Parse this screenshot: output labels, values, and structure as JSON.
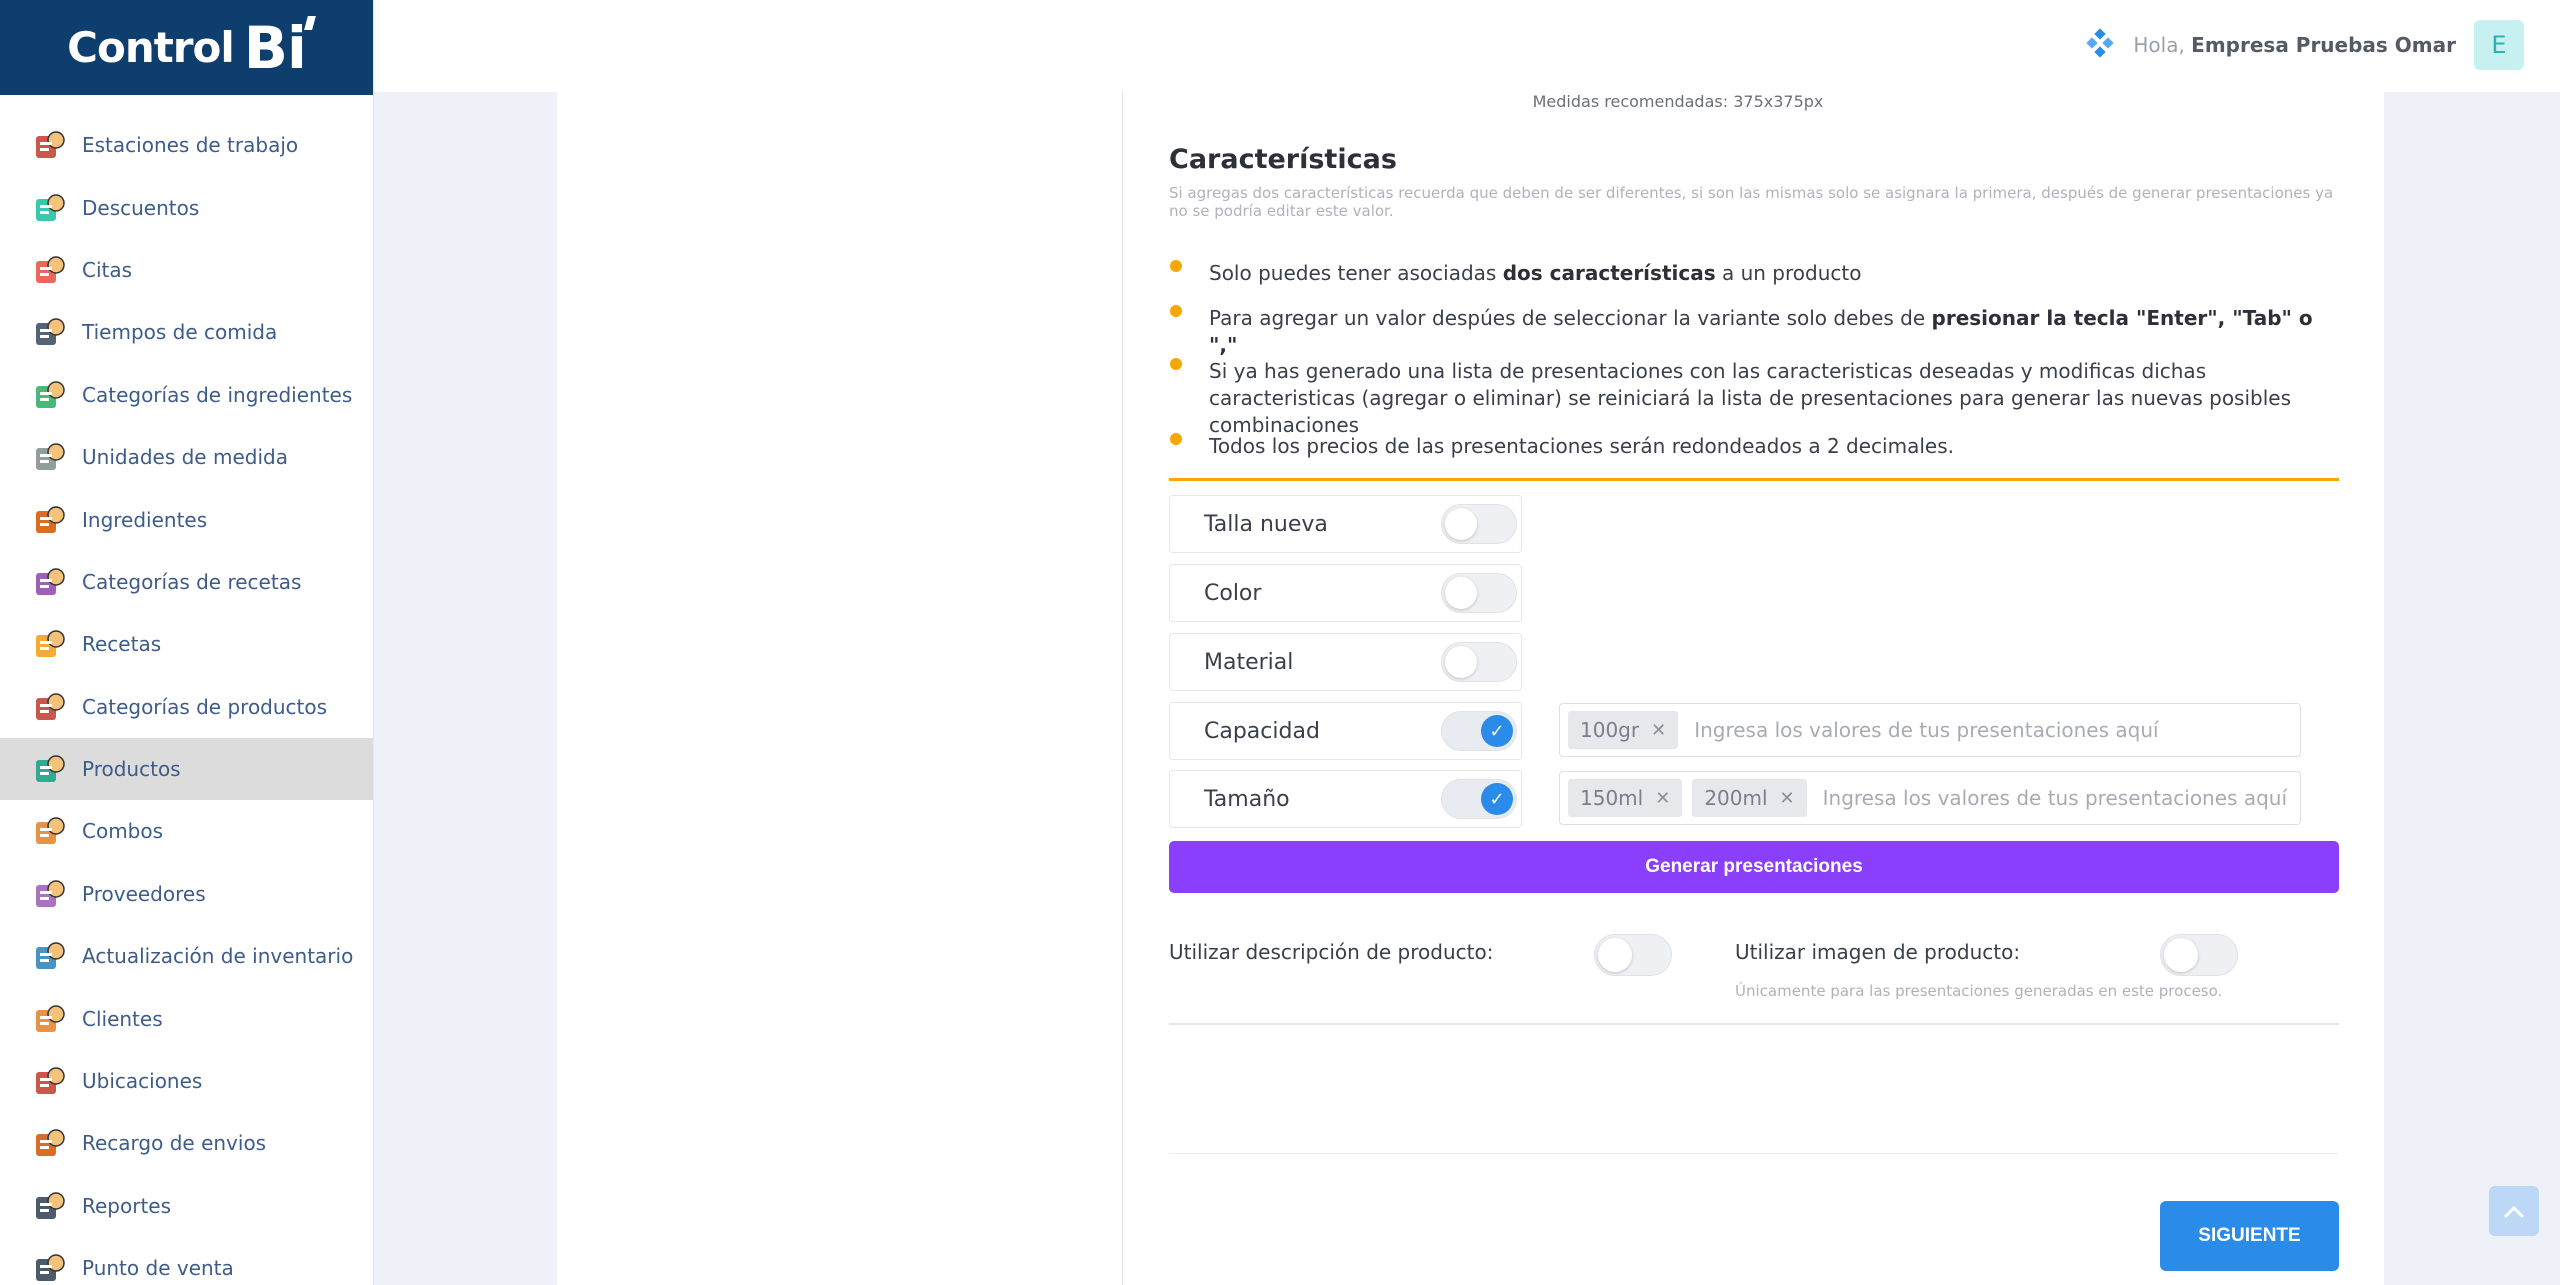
{
  "brand": {
    "name": "Control",
    "suffix": "Bi"
  },
  "sidebar": {
    "items": [
      {
        "label": "Estaciones de trabajo",
        "icon": "workstation-icon",
        "color": "#c0392b"
      },
      {
        "label": "Descuentos",
        "icon": "discount-icon",
        "color": "#1abc9c"
      },
      {
        "label": "Citas",
        "icon": "calendar-icon",
        "color": "#e74c3c"
      },
      {
        "label": "Tiempos de comida",
        "icon": "meal-time-icon",
        "color": "#34495e"
      },
      {
        "label": "Categorías de ingredientes",
        "icon": "ingredient-category-icon",
        "color": "#27ae60"
      },
      {
        "label": "Unidades de medida",
        "icon": "measure-icon",
        "color": "#7f8c8d"
      },
      {
        "label": "Ingredientes",
        "icon": "ingredients-icon",
        "color": "#d35400"
      },
      {
        "label": "Categorías de recetas",
        "icon": "recipe-category-icon",
        "color": "#8e44ad"
      },
      {
        "label": "Recetas",
        "icon": "recipe-icon",
        "color": "#f39c12"
      },
      {
        "label": "Categorías de productos",
        "icon": "product-category-icon",
        "color": "#c0392b"
      },
      {
        "label": "Productos",
        "icon": "products-icon",
        "color": "#16a085"
      },
      {
        "label": "Combos",
        "icon": "combo-icon",
        "color": "#e67e22"
      },
      {
        "label": "Proveedores",
        "icon": "supplier-icon",
        "color": "#9b59b6"
      },
      {
        "label": "Actualización de inventario",
        "icon": "inventory-icon",
        "color": "#2980b9"
      },
      {
        "label": "Clientes",
        "icon": "clients-icon",
        "color": "#e67e22"
      },
      {
        "label": "Ubicaciones",
        "icon": "location-icon",
        "color": "#c0392b"
      },
      {
        "label": "Recargo de envios",
        "icon": "delivery-icon",
        "color": "#d35400"
      },
      {
        "label": "Reportes",
        "icon": "reports-icon",
        "color": "#2c3e50"
      },
      {
        "label": "Punto de venta",
        "icon": "pos-icon",
        "color": "#2c3e50"
      }
    ],
    "active_index": 10
  },
  "header": {
    "greeting": "Hola,",
    "user": "Empresa Pruebas Omar",
    "avatar_letter": "E"
  },
  "form": {
    "medidas": "Medidas recomendadas: 375x375px",
    "title": "Características",
    "subtitle": "Si agregas dos características recuerda que deben de ser diferentes, si son las mismas solo se asignara la primera, después de generar presentaciones ya no se podría editar este valor.",
    "rules": {
      "r1_a": "Solo puedes tener asociadas ",
      "r1_b": "dos características",
      "r1_c": " a un producto",
      "r2_a": "Para agregar un valor despúes de seleccionar la variante solo debes de ",
      "r2_b": "presionar la tecla \"Enter\", \"Tab\" o \",\"",
      "r3": "Si ya has generado una lista de presentaciones con las caracteristicas deseadas y modificas dichas caracteristicas (agregar o eliminar) se reiniciará la lista de presentaciones para generar las nuevas posibles combinaciones",
      "r4": "Todos los precios de las presentaciones serán redondeados a 2 decimales."
    },
    "features": [
      {
        "label": "Talla nueva",
        "enabled": false
      },
      {
        "label": "Color",
        "enabled": false
      },
      {
        "label": "Material",
        "enabled": false
      },
      {
        "label": "Capacidad",
        "enabled": true,
        "tags": [
          "100gr"
        ]
      },
      {
        "label": "Tamaño",
        "enabled": true,
        "tags": [
          "150ml",
          "200ml"
        ]
      }
    ],
    "tag_placeholder": "Ingresa los valores de tus presentaciones aquí",
    "generate_label": "Generar presentaciones",
    "use_description_label": "Utilizar descripción de producto:",
    "use_image_label": "Utilizar imagen de producto:",
    "use_image_note": "Únicamente para las presentaciones generadas en este proceso.",
    "next_label": "SIGUIENTE"
  },
  "colors": {
    "primary": "#2b8be8",
    "accent": "#8a3ffc",
    "warning": "#f5a800",
    "brand": "#0d3e6e"
  }
}
